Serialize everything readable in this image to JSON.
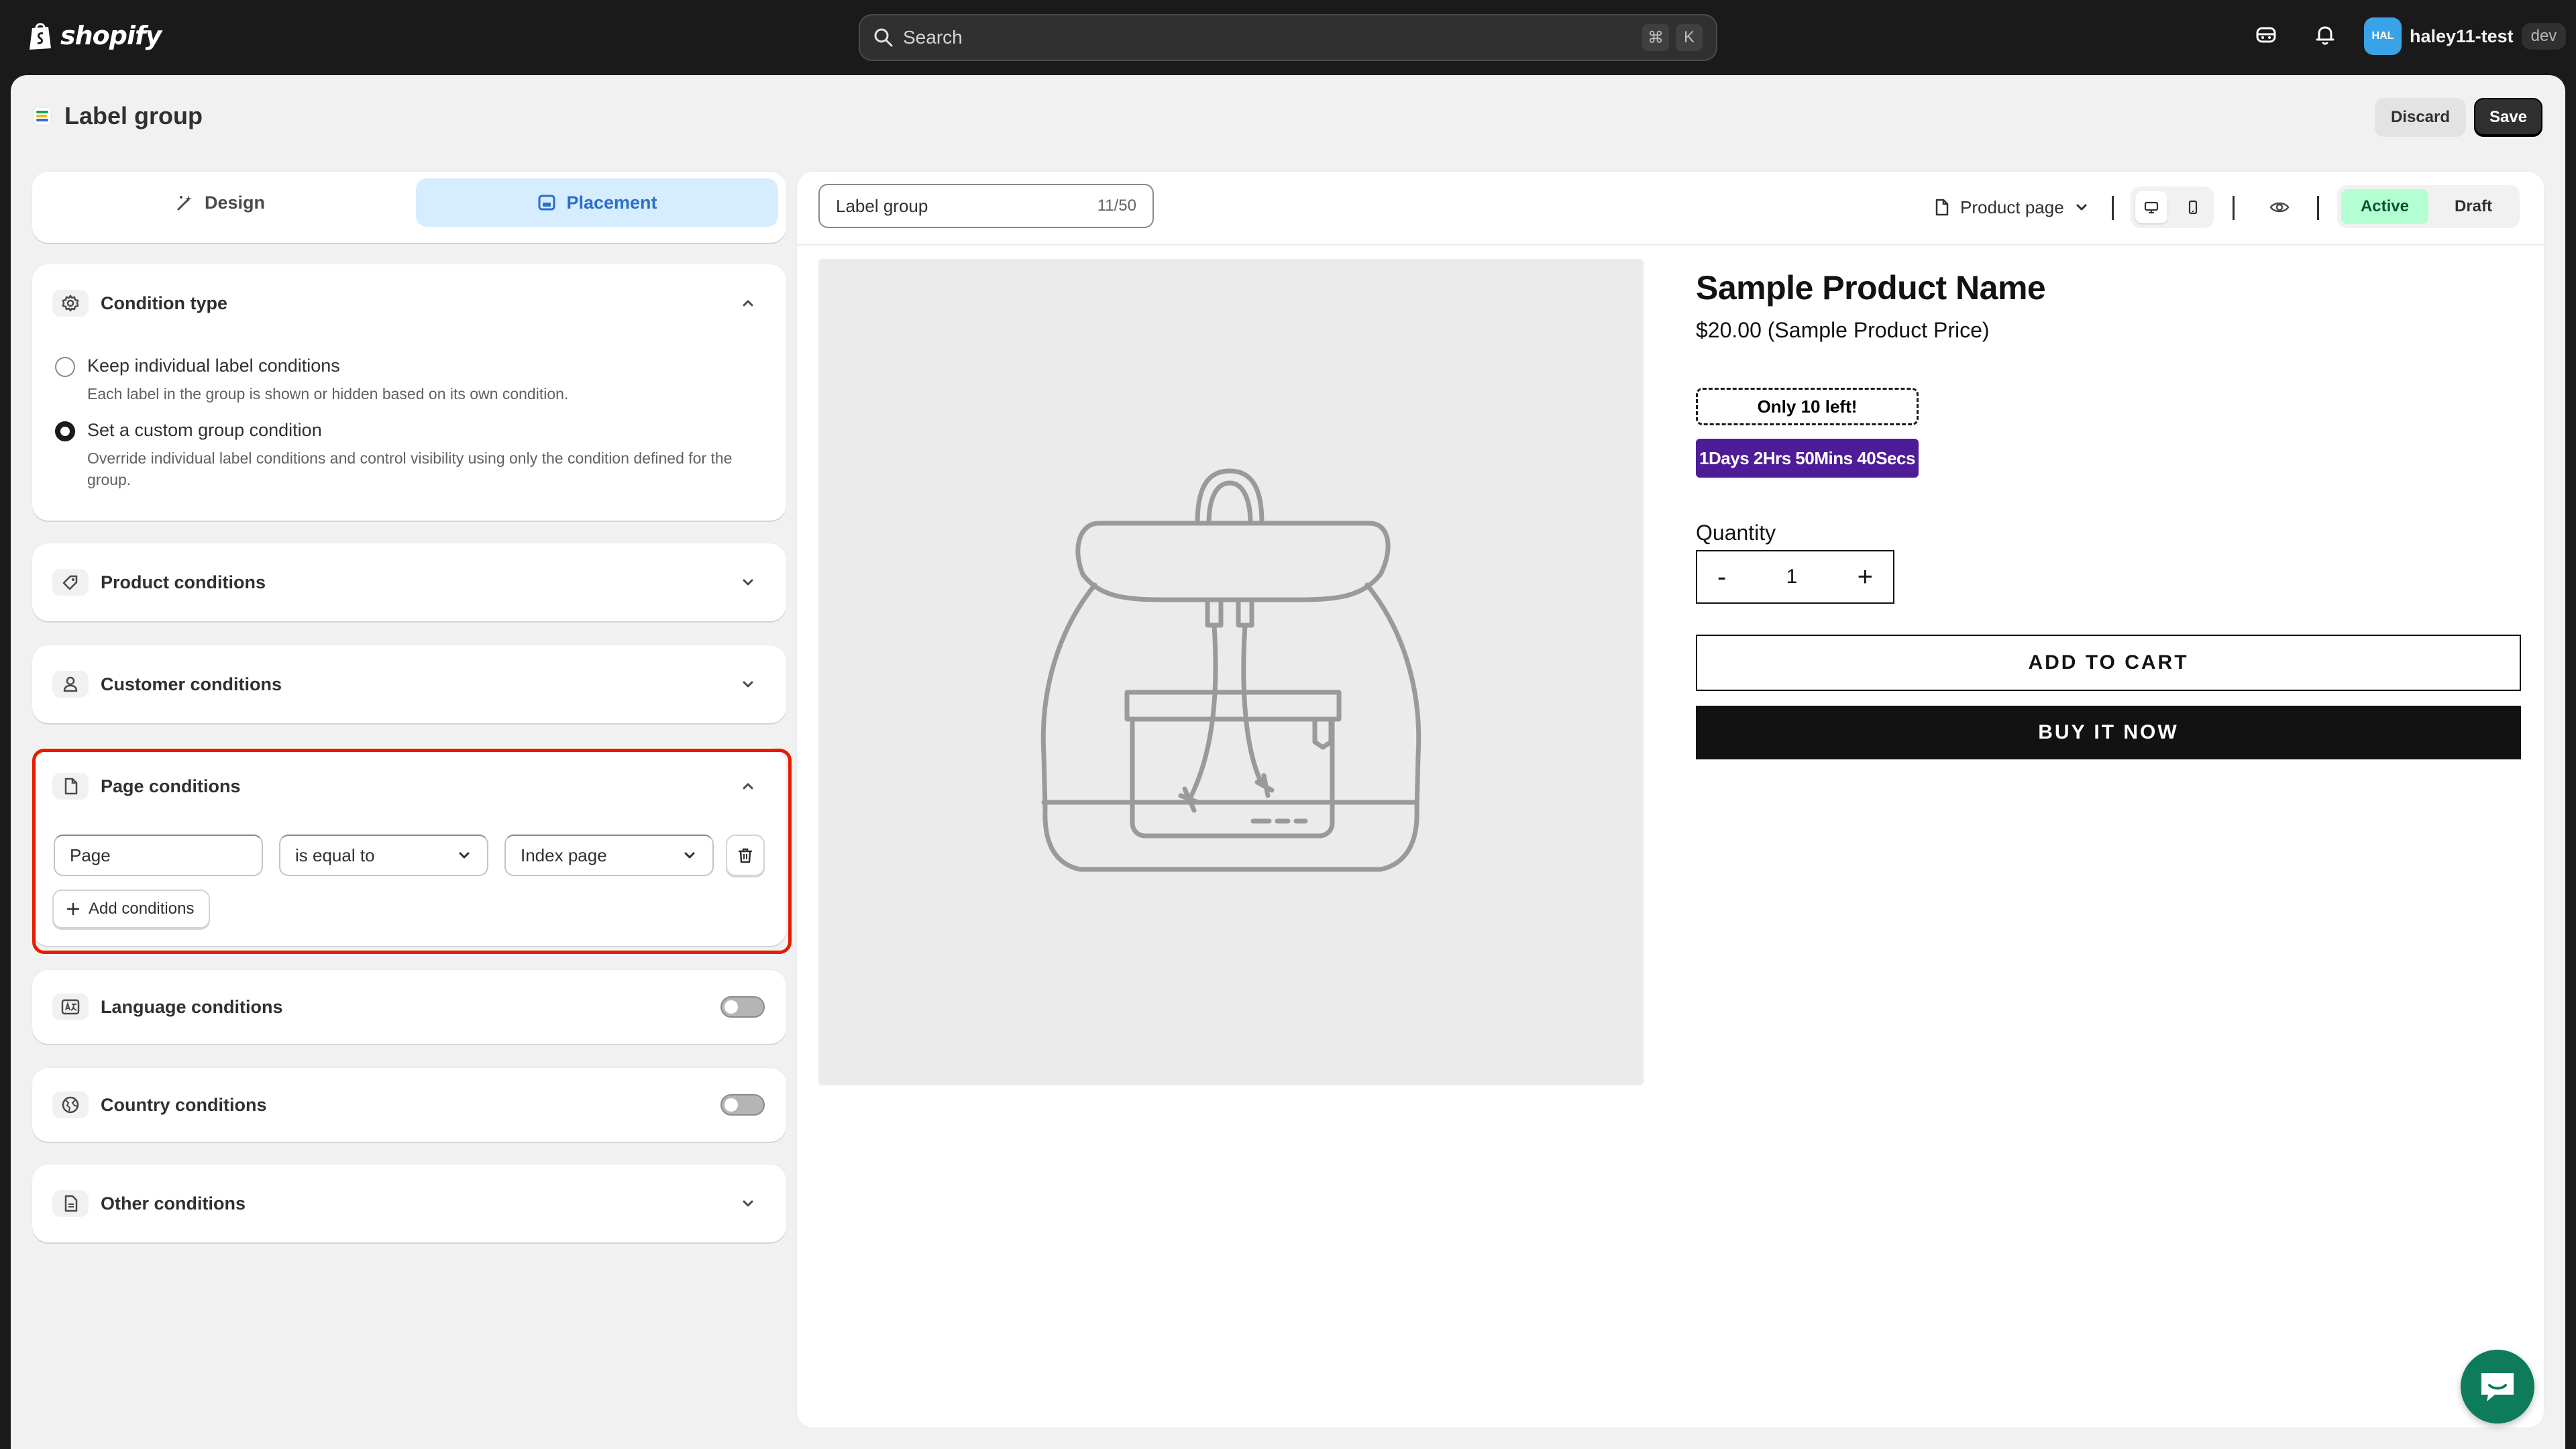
{
  "topbar": {
    "brand": "shopify",
    "search_placeholder": "Search",
    "shortcut_key1": "⌘",
    "shortcut_key2": "K",
    "account_initials": "HAL",
    "store_name": "haley11-test",
    "store_tag": "dev"
  },
  "page": {
    "title": "Label group",
    "discard_label": "Discard",
    "save_label": "Save"
  },
  "tabs": [
    {
      "label": "Design",
      "icon": "magic-wand-icon",
      "selected": false
    },
    {
      "label": "Placement",
      "icon": "layout-icon",
      "selected": true
    }
  ],
  "condition_type": {
    "title": "Condition type",
    "options": [
      {
        "label": "Keep individual label conditions",
        "help": "Each label in the group is shown or hidden based on its own condition.",
        "selected": false
      },
      {
        "label": "Set a custom group condition",
        "help": "Override individual label conditions and control visibility using only the condition defined for the group.",
        "selected": true
      }
    ]
  },
  "sections": {
    "product": "Product conditions",
    "customer": "Customer conditions",
    "page": "Page conditions",
    "language": "Language conditions",
    "country": "Country conditions",
    "other": "Other conditions"
  },
  "page_condition": {
    "field": "Page",
    "operator": "is equal to",
    "value": "Index page",
    "add_label": "Add conditions"
  },
  "preview": {
    "group_name": "Label group",
    "name_count": "11/50",
    "page_selector": "Product page",
    "status_active": "Active",
    "status_draft": "Draft"
  },
  "product": {
    "name": "Sample Product Name",
    "price": "$20.00 (Sample Product Price)",
    "badge_stock": "Only 10 left!",
    "badge_timer": "1Days 2Hrs 50Mins 40Secs",
    "quantity_label": "Quantity",
    "quantity_minus": "-",
    "quantity_value": "1",
    "quantity_plus": "+",
    "add_to_cart": "ADD TO CART",
    "buy_now": "BUY IT NOW"
  },
  "colors": {
    "accent_tab": "#d6ecff",
    "accent_tab_text": "#2c6ecb",
    "highlight_border": "#e51c00",
    "timer_badge": "#4f1c98",
    "active_status": "#b4fed2",
    "chat_button": "#0e7c5b"
  }
}
